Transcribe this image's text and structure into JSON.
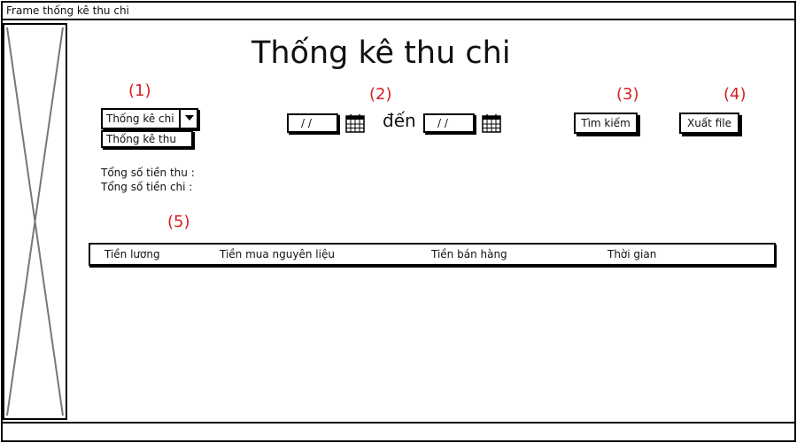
{
  "window": {
    "title": "Frame thống kê thu chi"
  },
  "page": {
    "title": "Thống kê thu chi"
  },
  "markers": [
    "(1)",
    "(2)",
    "(3)",
    "(4)",
    "(5)"
  ],
  "filter": {
    "type_selected": "Thống kê chi",
    "type_option": "Thống kê thu",
    "date_from": "/ /",
    "date_to": "/ /",
    "to_label": "đến"
  },
  "actions": {
    "search_label": "Tìm kiếm",
    "export_label": "Xuất file"
  },
  "totals": {
    "income_label": "Tổng số tiền thu :",
    "expense_label": "Tổng số tiền chi :"
  },
  "table": {
    "columns": [
      "Tiền lương",
      "Tiền mua nguyên liệu",
      "Tiền bán hàng",
      "Thời gian"
    ]
  },
  "icons": {
    "calendar": "calendar-icon",
    "dropdown": "chevron-down-icon",
    "placeholder": "image-placeholder-icon"
  }
}
